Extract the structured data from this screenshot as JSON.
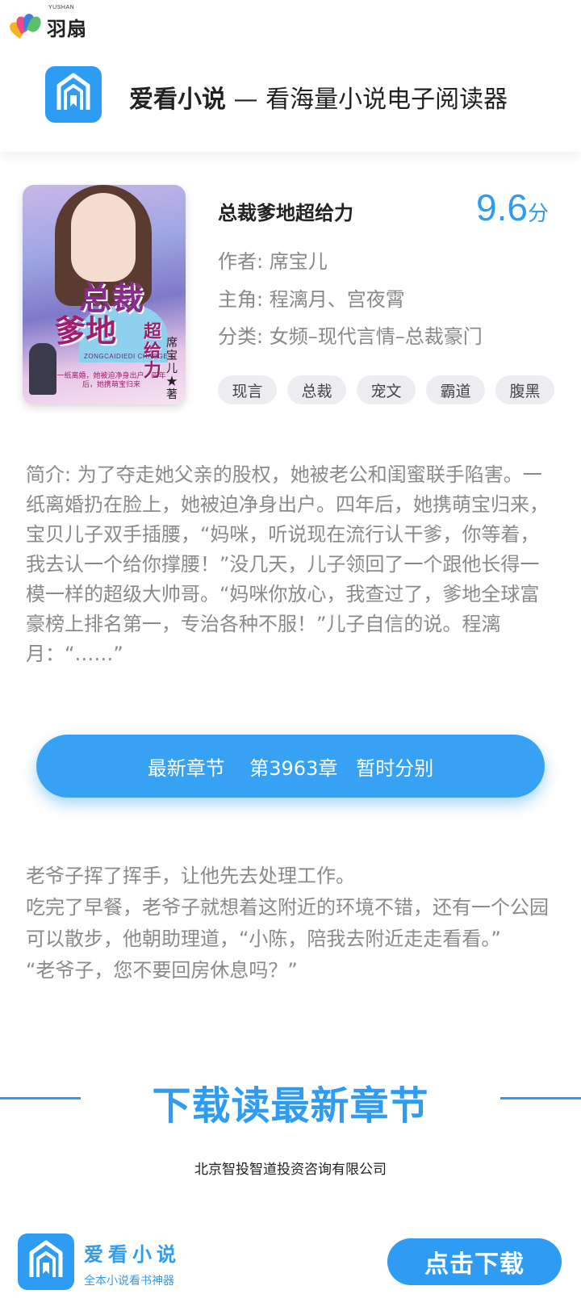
{
  "brand": {
    "logo_en": "YUSHAN",
    "logo_cn": "羽扇"
  },
  "app_header": {
    "app_name": "爱看小说",
    "separator": "—",
    "tagline": "看海量小说电子阅读器",
    "icon": "bookmark-house-icon"
  },
  "book": {
    "title": "总裁爹地超给力",
    "rating_value": "9.6",
    "rating_unit": "分",
    "author": "作者: 席宝儿",
    "lead": "主角: 程漓月、宫夜霄",
    "category": "分类: 女频–现代言情–总裁豪门",
    "tags": [
      "现言",
      "总裁",
      "宠文",
      "霸道",
      "腹黑"
    ],
    "cover": {
      "title_line1": "总裁",
      "title_line2": "爹地",
      "title_line3": "超给力",
      "author": "席宝儿★著",
      "pinyin": "ZONGCAIDIEDI CHAOGEILI",
      "blurb": "一纸离婚，她被迫净身出户。四年后，她携萌宝归来"
    }
  },
  "intro": "简介: 为了夺走她父亲的股权，她被老公和闺蜜联手陷害。一纸离婚扔在脸上，她被迫净身出户。四年后，她携萌宝归来，宝贝儿子双手插腰，“妈咪，听说现在流行认干爹，你等着，我去认一个给你撑腰！”没几天，儿子领回了一个跟他长得一模一样的超级大帅哥。“妈咪你放心，我查过了，爹地全球富豪榜上排名第一，专治各种不服！”儿子自信的说。程漓月：“……”",
  "latest_chapter": {
    "label": "最新章节    第3963章   暂时分别"
  },
  "excerpt": {
    "paragraphs": [
      "老爷子挥了挥手，让他先去处理工作。",
      "吃完了早餐，老爷子就想着这附近的环境不错，还有一个公园可以散步，他朝助理道，“小陈，陪我去附近走走看看。”",
      "“老爷子，您不要回房休息吗？”"
    ]
  },
  "download_section": {
    "title": "下载读最新章节"
  },
  "company": "北京智投智道投资咨询有限公司",
  "footer": {
    "app_name": "爱看小说",
    "slogan": "全本小说看书神器",
    "download_button": "点击下载",
    "icon": "bookmark-house-icon"
  },
  "colors": {
    "accent": "#2f9cf4",
    "muted_text": "#8a8a8a",
    "tag_bg": "#ededf1"
  }
}
